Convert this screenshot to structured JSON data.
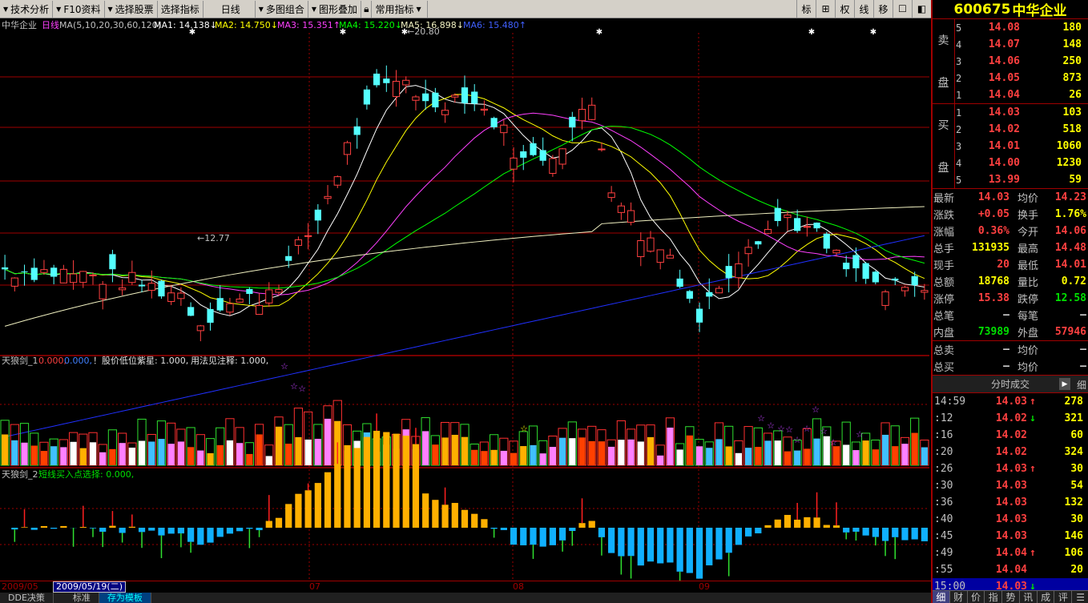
{
  "toolbar": {
    "items": [
      "技术分析",
      "F10资料",
      "选择股票",
      "选择指标",
      "日线",
      "多图组合",
      "图形叠加",
      "常用指标"
    ],
    "right_buttons": [
      "标",
      "⊞",
      "权",
      "线",
      "移",
      "☐",
      "◧"
    ]
  },
  "stock": {
    "code": "600675",
    "name": "中华企业"
  },
  "main_legend": {
    "title": "中华企业",
    "period": "日线",
    "ma_spec": "MA(5,10,20,30,60,120)",
    "ma1": "MA1: 14.138↓",
    "ma2": "MA2: 14.750↓",
    "ma3": "MA3: 15.351↑",
    "ma4": "MA4: 15.220↓",
    "ma5": "MA5: 16.898↓",
    "ma6": "MA6: 15.480↑"
  },
  "annotations": {
    "high_label": "20.80",
    "low_label": "12.77"
  },
  "ind1_legend": {
    "name": "天狼剑_1",
    "v1": "0.000,",
    "v2": "0.000,",
    "v3": "！股价低位紫星: 1.000,",
    "v4": "用法见注释: 1.000,"
  },
  "ind2_legend": {
    "name": "天狼剑_2",
    "v1": "短线买入点选择: 0.000,"
  },
  "date_axis": {
    "cursor_date": "2009/05/19(二)",
    "left_date": "2009/05",
    "months": [
      "07",
      "08",
      "09"
    ]
  },
  "bottom_tabs": [
    "DDE决策",
    "标准",
    "存为模板"
  ],
  "order_book": {
    "sell_label": [
      "卖",
      "盘"
    ],
    "buy_label": [
      "买",
      "盘"
    ],
    "sell": [
      {
        "lv": "5",
        "price": "14.08",
        "vol": "180"
      },
      {
        "lv": "4",
        "price": "14.07",
        "vol": "148"
      },
      {
        "lv": "3",
        "price": "14.06",
        "vol": "250"
      },
      {
        "lv": "2",
        "price": "14.05",
        "vol": "873"
      },
      {
        "lv": "1",
        "price": "14.04",
        "vol": "26"
      }
    ],
    "buy": [
      {
        "lv": "1",
        "price": "14.03",
        "vol": "103"
      },
      {
        "lv": "2",
        "price": "14.02",
        "vol": "518"
      },
      {
        "lv": "3",
        "price": "14.01",
        "vol": "1060"
      },
      {
        "lv": "4",
        "price": "14.00",
        "vol": "1230"
      },
      {
        "lv": "5",
        "price": "13.99",
        "vol": "59"
      }
    ]
  },
  "quote": [
    {
      "l1": "最新",
      "v1": "14.03",
      "c1": "up",
      "l2": "均价",
      "v2": "14.23",
      "c2": "up"
    },
    {
      "l1": "涨跌",
      "v1": "+0.05",
      "c1": "up",
      "l2": "换手",
      "v2": "1.76%",
      "c2": "yl"
    },
    {
      "l1": "涨幅",
      "v1": "0.36%",
      "c1": "up",
      "l2": "今开",
      "v2": "14.06",
      "c2": "up"
    },
    {
      "l1": "总手",
      "v1": "131935",
      "c1": "yl",
      "l2": "最高",
      "v2": "14.48",
      "c2": "up"
    },
    {
      "l1": "现手",
      "v1": "20",
      "c1": "up",
      "l2": "最低",
      "v2": "14.01",
      "c2": "up"
    },
    {
      "l1": "总额",
      "v1": "18768",
      "c1": "yl",
      "l2": "量比",
      "v2": "0.72",
      "c2": "yl"
    },
    {
      "l1": "涨停",
      "v1": "15.38",
      "c1": "up",
      "l2": "跌停",
      "v2": "12.58",
      "c2": "dn"
    },
    {
      "l1": "总笔",
      "v1": "–",
      "c1": "wh",
      "l2": "每笔",
      "v2": "–",
      "c2": "wh"
    },
    {
      "l1": "内盘",
      "v1": "73989",
      "c1": "dn",
      "l2": "外盘",
      "v2": "57946",
      "c2": "up"
    }
  ],
  "quote2": [
    {
      "l1": "总卖",
      "v1": "–",
      "c1": "wh",
      "l2": "均价",
      "v2": "–",
      "c2": "wh"
    },
    {
      "l1": "总买",
      "v1": "–",
      "c1": "wh",
      "l2": "均价",
      "v2": "–",
      "c2": "wh"
    }
  ],
  "ticks_title": "分时成交",
  "ticks_tab": "细",
  "ticks": [
    {
      "t": "14:59",
      "p": "14.03",
      "a": "↑",
      "ad": "up",
      "v": "278"
    },
    {
      "t": ":12",
      "p": "14.02",
      "a": "↓",
      "ad": "dn",
      "v": "321"
    },
    {
      "t": ":16",
      "p": "14.02",
      "a": "",
      "ad": "",
      "v": "60"
    },
    {
      "t": ":20",
      "p": "14.02",
      "a": "",
      "ad": "",
      "v": "324"
    },
    {
      "t": ":26",
      "p": "14.03",
      "a": "↑",
      "ad": "up",
      "v": "30"
    },
    {
      "t": ":30",
      "p": "14.03",
      "a": "",
      "ad": "",
      "v": "54"
    },
    {
      "t": ":36",
      "p": "14.03",
      "a": "",
      "ad": "",
      "v": "132"
    },
    {
      "t": ":40",
      "p": "14.03",
      "a": "",
      "ad": "",
      "v": "30"
    },
    {
      "t": ":45",
      "p": "14.03",
      "a": "",
      "ad": "",
      "v": "146"
    },
    {
      "t": ":49",
      "p": "14.04",
      "a": "↑",
      "ad": "up",
      "v": "106"
    },
    {
      "t": ":55",
      "p": "14.04",
      "a": "",
      "ad": "",
      "v": "20"
    },
    {
      "t": "15:00",
      "p": "14.03",
      "a": "↓",
      "ad": "dn",
      "v": ""
    }
  ],
  "panel_tabs": [
    "细",
    "财",
    "价",
    "指",
    "势",
    "讯",
    "成",
    "评",
    "☰"
  ],
  "colors": {
    "up": "#ff4040",
    "down": "#54ffff",
    "ma1": "#ffffff",
    "ma2": "#ffff00",
    "ma3": "#ff40ff",
    "ma4": "#00ff00",
    "ma5": "#f0f0c0",
    "ma6": "#2030ff",
    "grid": "#a00000"
  },
  "chart_data": {
    "type": "candlestick",
    "price_range": [
      12.77,
      20.8
    ],
    "annotated_high": 20.8,
    "annotated_low": 12.77,
    "last_close": 14.03,
    "moving_averages": {
      "MA1": 14.138,
      "MA2": 14.75,
      "MA3": 15.351,
      "MA4": 15.22,
      "MA5": 16.898,
      "MA6": 15.48
    },
    "x_months": [
      "2009/05",
      "07",
      "08",
      "09"
    ]
  }
}
